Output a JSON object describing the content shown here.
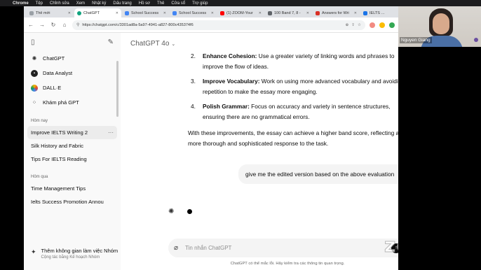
{
  "menubar": {
    "app": "Chrome",
    "menus": [
      "Tệp",
      "Chỉnh sửa",
      "Xem",
      "Nhật ký",
      "Dấu trang",
      "Hồ sơ",
      "Thẻ",
      "Cửa sổ",
      "Trợ giúp"
    ]
  },
  "tabs": [
    {
      "label": "Thẻ mới",
      "color": "#9aa0a6"
    },
    {
      "label": "ChatGPT",
      "color": "#10a37f",
      "active": true
    },
    {
      "label": "School Success",
      "color": "#4285f4"
    },
    {
      "label": "School Success",
      "color": "#4285f4"
    },
    {
      "label": "(1) ZOOM-Your",
      "color": "#ff0000"
    },
    {
      "label": "100 Band 7, 8 -",
      "color": "#5f6368"
    },
    {
      "label": "Answers for Wri",
      "color": "#d93025"
    },
    {
      "label": "IELTS Ma",
      "color": "#1a73e8"
    }
  ],
  "address": {
    "url": "https://chatgpt.com/c/3301ad8a-5a97-4941-a827-800c435374f6"
  },
  "sidebar": {
    "nav": [
      {
        "label": "ChatGPT",
        "icon": "openai-logo-icon"
      },
      {
        "label": "Data Analyst",
        "icon": "data-analyst-icon"
      },
      {
        "label": "DALL·E",
        "icon": "dalle-icon"
      },
      {
        "label": "Khám phá GPT",
        "icon": "grid-icon"
      }
    ],
    "today_heading": "Hôm nay",
    "today": [
      {
        "label": "Improve IELTS Writing 2",
        "active": true
      },
      {
        "label": "Silk History and Fabric"
      },
      {
        "label": "Tips For IELTS Reading"
      }
    ],
    "yesterday_heading": "Hôm qua",
    "yesterday": [
      {
        "label": "Time Management Tips"
      },
      {
        "label": "Ielts Success Promotion Annou"
      }
    ],
    "upgrade_title": "Thêm không gian làm việc Nhóm",
    "upgrade_subtitle": "Cộng tác bằng Kế hoạch Nhóm"
  },
  "main": {
    "model_label": "ChatGPT 4o",
    "list": [
      {
        "num": "2.",
        "title": "Enhance Cohesion:",
        "text": " Use a greater variety of linking words and phrases to improve the flow of ideas."
      },
      {
        "num": "3.",
        "title": "Improve Vocabulary:",
        "text": " Work on using more advanced vocabulary and avoiding repetition to make the essay more engaging."
      },
      {
        "num": "4.",
        "title": "Polish Grammar:",
        "text": " Focus on accuracy and variety in sentence structures, ensuring there are no grammatical errors."
      }
    ],
    "conclusion": "With these improvements, the essay can achieve a higher band score, reflecting a more thorough and sophisticated response to the task.",
    "user_message": "give me the edited version based on the above evaluation",
    "composer_placeholder": "Tin nhắn ChatGPT",
    "disclaimer": "ChatGPT có thể mắc lỗi. Hãy kiểm tra các thông tin quan trọng.",
    "help": "?"
  },
  "video": {
    "participant_name": "Nguyen Giang"
  },
  "watermark": "zoom"
}
